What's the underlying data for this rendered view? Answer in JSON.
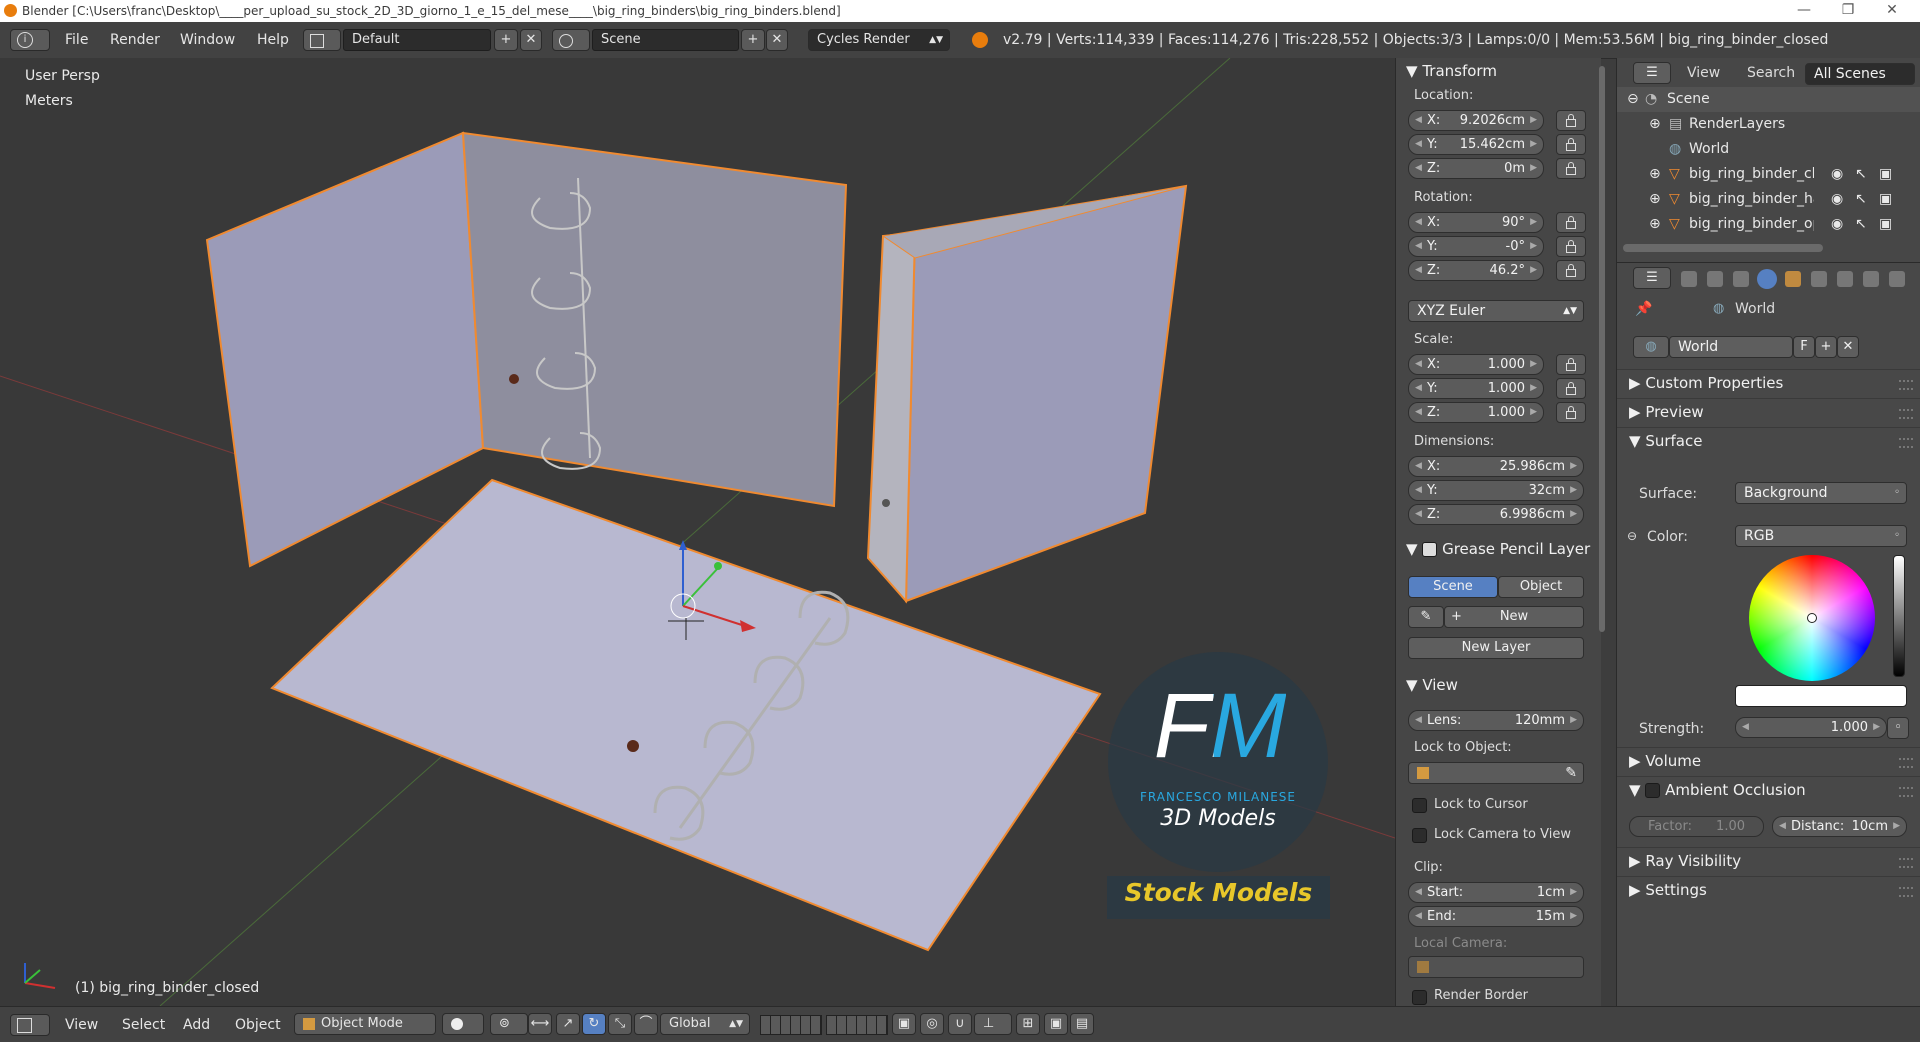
{
  "titlebar": {
    "title": "Blender [C:\\Users\\franc\\Desktop\\____per_upload_su_stock_2D_3D_giorno_1_e_15_del_mese____\\big_ring_binders\\big_ring_binders.blend]",
    "minimize": "—",
    "restore": "❐",
    "close": "✕"
  },
  "info": {
    "menus": [
      "File",
      "Render",
      "Window",
      "Help"
    ],
    "layout": "Default",
    "scene": "Scene",
    "engine": "Cycles Render",
    "stats": "v2.79 | Verts:114,339 | Faces:114,276 | Tris:228,552 | Objects:3/3 | Lamps:0/0 | Mem:53.56M | big_ring_binder_closed"
  },
  "viewport": {
    "view_name": "User Persp",
    "units": "Meters",
    "object_label": "(1) big_ring_binder_closed",
    "watermark_big": "FM",
    "watermark_name": "FRANCESCO MILANESE",
    "watermark_sub": "3D Models",
    "watermark_stock": "Stock Models"
  },
  "npanel": {
    "transform": {
      "title": "Transform",
      "location_label": "Location:",
      "location": [
        {
          "axis": "X:",
          "value": "9.2026cm"
        },
        {
          "axis": "Y:",
          "value": "15.462cm"
        },
        {
          "axis": "Z:",
          "value": "0m"
        }
      ],
      "rotation_label": "Rotation:",
      "rotation": [
        {
          "axis": "X:",
          "value": "90°"
        },
        {
          "axis": "Y:",
          "value": "-0°"
        },
        {
          "axis": "Z:",
          "value": "46.2°"
        }
      ],
      "rotation_mode": "XYZ Euler",
      "scale_label": "Scale:",
      "scale": [
        {
          "axis": "X:",
          "value": "1.000"
        },
        {
          "axis": "Y:",
          "value": "1.000"
        },
        {
          "axis": "Z:",
          "value": "1.000"
        }
      ],
      "dimensions_label": "Dimensions:",
      "dimensions": [
        {
          "axis": "X:",
          "value": "25.986cm"
        },
        {
          "axis": "Y:",
          "value": "32cm"
        },
        {
          "axis": "Z:",
          "value": "6.9986cm"
        }
      ]
    },
    "grease": {
      "title": "Grease Pencil Layer",
      "tab_scene": "Scene",
      "tab_object": "Object",
      "new": "New",
      "new_layer": "New Layer"
    },
    "view": {
      "title": "View",
      "lens_label": "Lens:",
      "lens_value": "120mm",
      "lock_object": "Lock to Object:",
      "lock_cursor": "Lock to Cursor",
      "lock_camera": "Lock Camera to View",
      "clip": "Clip:",
      "start_label": "Start:",
      "start_value": "1cm",
      "end_label": "End:",
      "end_value": "15m",
      "local_camera": "Local Camera:",
      "render_border": "Render Border"
    }
  },
  "outliner": {
    "menus": [
      "View",
      "Search"
    ],
    "scope": "All Scenes",
    "items": [
      "Scene",
      "RenderLayers",
      "World",
      "big_ring_binder_clos",
      "big_ring_binder_hal",
      "big_ring_binder_ope"
    ]
  },
  "properties": {
    "breadcrumb": "World",
    "world_name": "World",
    "world_f": "F",
    "sections": {
      "custom": "Custom Properties",
      "preview": "Preview",
      "surface": "Surface",
      "volume": "Volume",
      "ao": "Ambient Occlusion",
      "ray": "Ray Visibility",
      "settings": "Settings"
    },
    "surface_label": "Surface:",
    "surface_value": "Background",
    "color_label": "Color:",
    "color_mode": "RGB",
    "strength_label": "Strength:",
    "strength_value": "1.000",
    "factor_label": "Factor:",
    "factor_value": "1.00",
    "distance_label": "Distanc:",
    "distance_value": "10cm"
  },
  "bottom": {
    "menus": [
      "View",
      "Select",
      "Add",
      "Object"
    ],
    "mode": "Object Mode",
    "orientation": "Global"
  },
  "colors": {
    "accent_blue": "#5680c2",
    "selection_orange": "#f08a30",
    "watermark_blue": "#29a8e0",
    "stock_yellow": "#e8c72a"
  }
}
